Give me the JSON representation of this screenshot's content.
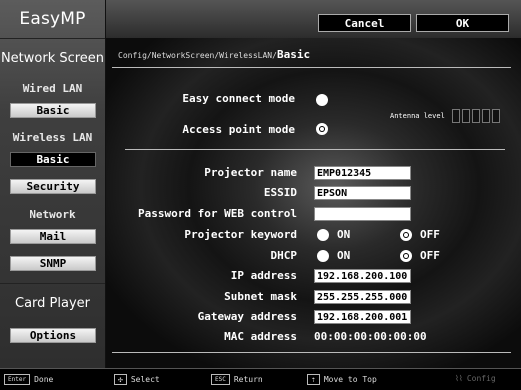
{
  "brand": "EasyMP",
  "sidebar": {
    "network_screen": "Network Screen",
    "wired_lan": "Wired LAN",
    "wired_basic": "Basic",
    "wireless_lan": "Wireless LAN",
    "wireless_basic": "Basic",
    "security": "Security",
    "network": "Network",
    "mail": "Mail",
    "snmp": "SNMP",
    "card_player": "Card Player",
    "options": "Options"
  },
  "topbar": {
    "cancel": "Cancel",
    "ok": "OK"
  },
  "breadcrumb": {
    "path": "Config/NetworkScreen/WirelessLAN/",
    "current": "Basic"
  },
  "mode": {
    "easy_connect": "Easy connect mode",
    "access_point": "Access point mode",
    "selected": "access_point",
    "antenna_label": "Antenna level"
  },
  "form": {
    "projector_name_label": "Projector name",
    "projector_name": "EMP012345",
    "essid_label": "ESSID",
    "essid": "EPSON",
    "web_password_label": "Password for WEB control",
    "web_password": "",
    "keyword_label": "Projector keyword",
    "on": "ON",
    "off": "OFF",
    "dhcp_label": "DHCP",
    "ip_label": "IP address",
    "ip": "192.168.200.100",
    "subnet_label": "Subnet mask",
    "subnet": "255.255.255.000",
    "gateway_label": "Gateway address",
    "gateway": "192.168.200.001",
    "mac_label": "MAC address",
    "mac": "00:00:00:00:00:00"
  },
  "footer": {
    "enter_key": "Enter",
    "done": "Done",
    "select": "Select",
    "esc_key": "ESC",
    "return": "Return",
    "move_top": "Move to Top",
    "config": "Config"
  }
}
